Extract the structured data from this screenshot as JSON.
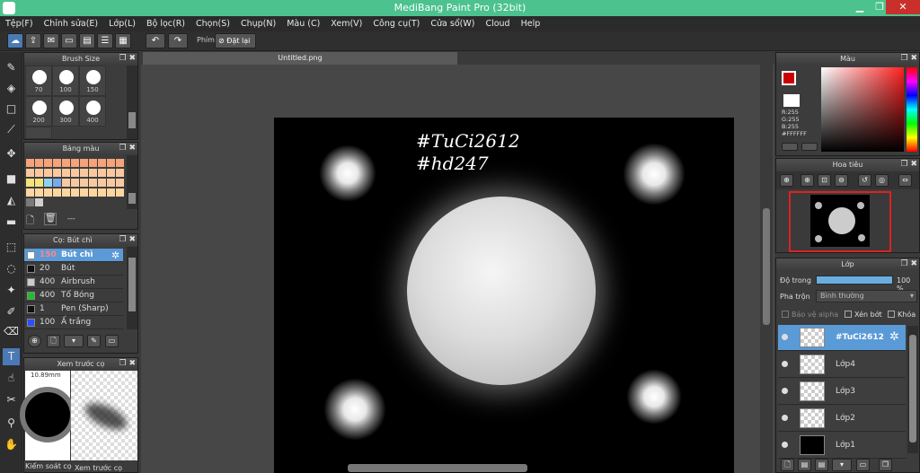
{
  "window": {
    "title": "MediBang Paint Pro (32bit)",
    "min": "▁",
    "max": "❐",
    "close": "✕"
  },
  "menu": [
    "Tệp(F)",
    "Chỉnh sửa(E)",
    "Lớp(L)",
    "Bộ lọc(R)",
    "Chọn(S)",
    "Chụp(N)",
    "Màu (C)",
    "Xem(V)",
    "Công cụ(T)",
    "Cửa sổ(W)",
    "Cloud",
    "Help"
  ],
  "toolbar": {
    "shortcut_label": "Phím",
    "reset_label": "Đặt lại"
  },
  "brush_size": {
    "title": "Brush Size",
    "sizes": [
      "70",
      "100",
      "150",
      "200",
      "300",
      "400"
    ]
  },
  "palette": {
    "title": "Bảng màu",
    "footer": "---"
  },
  "brushes": {
    "title": "Cọ: Bút chì",
    "items": [
      {
        "size": "150",
        "name": "Bút chì",
        "color": "#ffffff",
        "selected": true
      },
      {
        "size": "20",
        "name": "Bút",
        "color": "#111111",
        "selected": false
      },
      {
        "size": "400",
        "name": "Airbrush",
        "color": "#cccccc",
        "selected": false
      },
      {
        "size": "400",
        "name": "Tổ Bóng",
        "color": "#1fbf2a",
        "selected": false
      },
      {
        "size": "1",
        "name": "Pen (Sharp)",
        "color": "#111111",
        "selected": false
      },
      {
        "size": "100",
        "name": "Ấ trắng",
        "color": "#2a4fff",
        "selected": false
      }
    ]
  },
  "preview": {
    "title": "Xem trước cọ",
    "size_text": "10.89mm",
    "tabs": [
      "Kiểm soát cọ",
      "Xem trước cọ"
    ]
  },
  "document": {
    "tab": "Untitled.png",
    "text_line1": "#TuCi2612",
    "text_line2": "#hd247"
  },
  "color": {
    "title": "Màu",
    "r": "R:255",
    "g": "G:255",
    "b": "B:255",
    "hex": "#FFFFFF",
    "primary": "#cc0000",
    "secondary": "#ffffff"
  },
  "navigator": {
    "title": "Hoa tiêu"
  },
  "layer": {
    "title": "Lớp",
    "opacity_label": "Độ trong",
    "opacity_value": "100 %",
    "opacity": 1.0,
    "blend_label": "Pha trộn",
    "blend_value": "Bình thường",
    "protect_alpha": "Bảo vệ alpha",
    "clipping": "Xén bớt",
    "lock": "Khóa",
    "layers": [
      {
        "name": "#TuCi2612",
        "selected": true
      },
      {
        "name": "Lớp4",
        "selected": false
      },
      {
        "name": "Lớp3",
        "selected": false
      },
      {
        "name": "Lớp2",
        "selected": false
      },
      {
        "name": "Lớp1",
        "selected": false
      }
    ]
  }
}
